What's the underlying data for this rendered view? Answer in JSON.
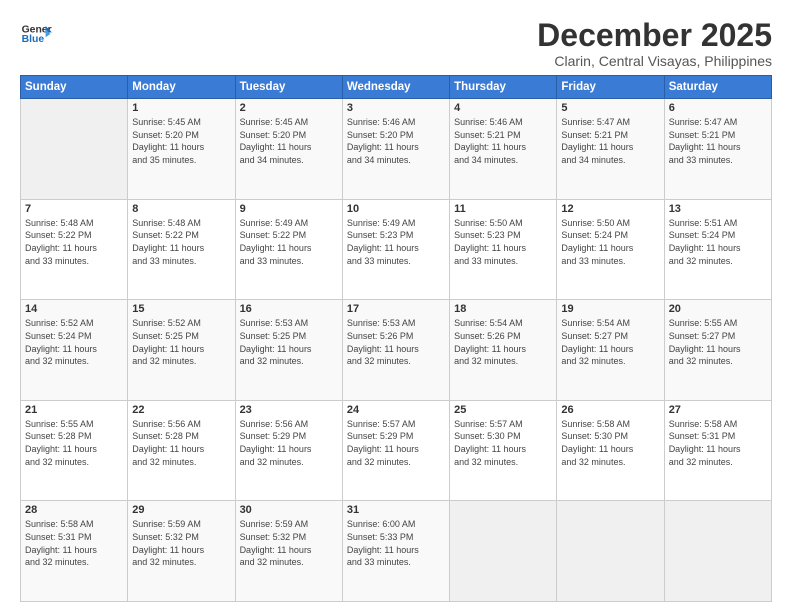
{
  "logo": {
    "line1": "General",
    "line2": "Blue"
  },
  "title": "December 2025",
  "location": "Clarin, Central Visayas, Philippines",
  "weekdays": [
    "Sunday",
    "Monday",
    "Tuesday",
    "Wednesday",
    "Thursday",
    "Friday",
    "Saturday"
  ],
  "weeks": [
    [
      {
        "day": "",
        "info": ""
      },
      {
        "day": "1",
        "info": "Sunrise: 5:45 AM\nSunset: 5:20 PM\nDaylight: 11 hours\nand 35 minutes."
      },
      {
        "day": "2",
        "info": "Sunrise: 5:45 AM\nSunset: 5:20 PM\nDaylight: 11 hours\nand 34 minutes."
      },
      {
        "day": "3",
        "info": "Sunrise: 5:46 AM\nSunset: 5:20 PM\nDaylight: 11 hours\nand 34 minutes."
      },
      {
        "day": "4",
        "info": "Sunrise: 5:46 AM\nSunset: 5:21 PM\nDaylight: 11 hours\nand 34 minutes."
      },
      {
        "day": "5",
        "info": "Sunrise: 5:47 AM\nSunset: 5:21 PM\nDaylight: 11 hours\nand 34 minutes."
      },
      {
        "day": "6",
        "info": "Sunrise: 5:47 AM\nSunset: 5:21 PM\nDaylight: 11 hours\nand 33 minutes."
      }
    ],
    [
      {
        "day": "7",
        "info": "Sunrise: 5:48 AM\nSunset: 5:22 PM\nDaylight: 11 hours\nand 33 minutes."
      },
      {
        "day": "8",
        "info": "Sunrise: 5:48 AM\nSunset: 5:22 PM\nDaylight: 11 hours\nand 33 minutes."
      },
      {
        "day": "9",
        "info": "Sunrise: 5:49 AM\nSunset: 5:22 PM\nDaylight: 11 hours\nand 33 minutes."
      },
      {
        "day": "10",
        "info": "Sunrise: 5:49 AM\nSunset: 5:23 PM\nDaylight: 11 hours\nand 33 minutes."
      },
      {
        "day": "11",
        "info": "Sunrise: 5:50 AM\nSunset: 5:23 PM\nDaylight: 11 hours\nand 33 minutes."
      },
      {
        "day": "12",
        "info": "Sunrise: 5:50 AM\nSunset: 5:24 PM\nDaylight: 11 hours\nand 33 minutes."
      },
      {
        "day": "13",
        "info": "Sunrise: 5:51 AM\nSunset: 5:24 PM\nDaylight: 11 hours\nand 32 minutes."
      }
    ],
    [
      {
        "day": "14",
        "info": "Sunrise: 5:52 AM\nSunset: 5:24 PM\nDaylight: 11 hours\nand 32 minutes."
      },
      {
        "day": "15",
        "info": "Sunrise: 5:52 AM\nSunset: 5:25 PM\nDaylight: 11 hours\nand 32 minutes."
      },
      {
        "day": "16",
        "info": "Sunrise: 5:53 AM\nSunset: 5:25 PM\nDaylight: 11 hours\nand 32 minutes."
      },
      {
        "day": "17",
        "info": "Sunrise: 5:53 AM\nSunset: 5:26 PM\nDaylight: 11 hours\nand 32 minutes."
      },
      {
        "day": "18",
        "info": "Sunrise: 5:54 AM\nSunset: 5:26 PM\nDaylight: 11 hours\nand 32 minutes."
      },
      {
        "day": "19",
        "info": "Sunrise: 5:54 AM\nSunset: 5:27 PM\nDaylight: 11 hours\nand 32 minutes."
      },
      {
        "day": "20",
        "info": "Sunrise: 5:55 AM\nSunset: 5:27 PM\nDaylight: 11 hours\nand 32 minutes."
      }
    ],
    [
      {
        "day": "21",
        "info": "Sunrise: 5:55 AM\nSunset: 5:28 PM\nDaylight: 11 hours\nand 32 minutes."
      },
      {
        "day": "22",
        "info": "Sunrise: 5:56 AM\nSunset: 5:28 PM\nDaylight: 11 hours\nand 32 minutes."
      },
      {
        "day": "23",
        "info": "Sunrise: 5:56 AM\nSunset: 5:29 PM\nDaylight: 11 hours\nand 32 minutes."
      },
      {
        "day": "24",
        "info": "Sunrise: 5:57 AM\nSunset: 5:29 PM\nDaylight: 11 hours\nand 32 minutes."
      },
      {
        "day": "25",
        "info": "Sunrise: 5:57 AM\nSunset: 5:30 PM\nDaylight: 11 hours\nand 32 minutes."
      },
      {
        "day": "26",
        "info": "Sunrise: 5:58 AM\nSunset: 5:30 PM\nDaylight: 11 hours\nand 32 minutes."
      },
      {
        "day": "27",
        "info": "Sunrise: 5:58 AM\nSunset: 5:31 PM\nDaylight: 11 hours\nand 32 minutes."
      }
    ],
    [
      {
        "day": "28",
        "info": "Sunrise: 5:58 AM\nSunset: 5:31 PM\nDaylight: 11 hours\nand 32 minutes."
      },
      {
        "day": "29",
        "info": "Sunrise: 5:59 AM\nSunset: 5:32 PM\nDaylight: 11 hours\nand 32 minutes."
      },
      {
        "day": "30",
        "info": "Sunrise: 5:59 AM\nSunset: 5:32 PM\nDaylight: 11 hours\nand 32 minutes."
      },
      {
        "day": "31",
        "info": "Sunrise: 6:00 AM\nSunset: 5:33 PM\nDaylight: 11 hours\nand 33 minutes."
      },
      {
        "day": "",
        "info": ""
      },
      {
        "day": "",
        "info": ""
      },
      {
        "day": "",
        "info": ""
      }
    ]
  ]
}
